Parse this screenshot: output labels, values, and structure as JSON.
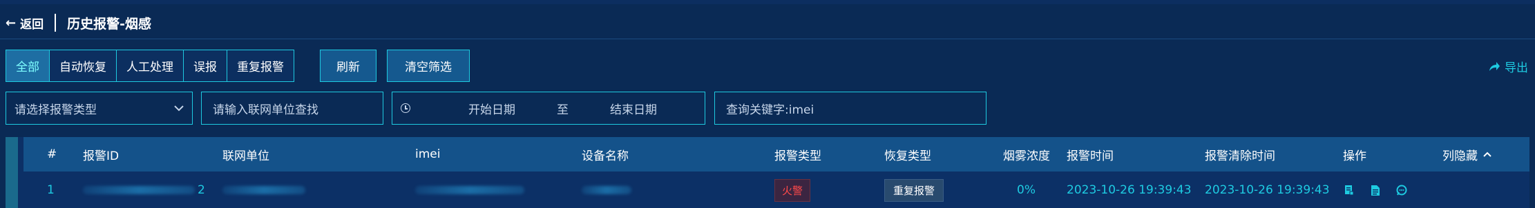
{
  "header": {
    "back_label": "返回",
    "title": "历史报警-烟感"
  },
  "filters": {
    "buttons": [
      "全部",
      "自动恢复",
      "人工处理",
      "误报",
      "重复报警"
    ],
    "active_index": 0,
    "refresh_label": "刷新",
    "clear_label": "清空筛选",
    "export_label": "导出"
  },
  "search": {
    "alarm_type_placeholder": "请选择报警类型",
    "unit_placeholder": "请输入联网单位查找",
    "start_date_placeholder": "开始日期",
    "date_separator": "至",
    "end_date_placeholder": "结束日期",
    "keyword_placeholder": "查询关键字:imei"
  },
  "table": {
    "columns": [
      "#",
      "报警ID",
      "联网单位",
      "imei",
      "设备名称",
      "报警类型",
      "恢复类型",
      "烟雾浓度",
      "报警时间",
      "报警清除时间",
      "操作",
      "列隐藏"
    ],
    "rows": [
      {
        "index": "1",
        "alarm_id_suffix": "2",
        "alarm_type": "火警",
        "recovery_type": "重复报警",
        "smoke_density": "0%",
        "alarm_time": "2023-10-26 19:39:43",
        "clear_time": "2023-10-26 19:39:43"
      }
    ]
  },
  "icons": {
    "back": "arrow-left-icon",
    "dropdown": "chevron-down-icon",
    "date": "clock-icon",
    "export": "export-arrow-icon",
    "col_toggle": "chevron-up-icon",
    "op1": "edit-icon",
    "op2": "document-icon",
    "op3": "comment-icon"
  },
  "colors": {
    "background": "#0a2a55",
    "accent": "#1ecbe1",
    "alarm_red": "#ff4a4a",
    "header_row": "#14528a"
  }
}
